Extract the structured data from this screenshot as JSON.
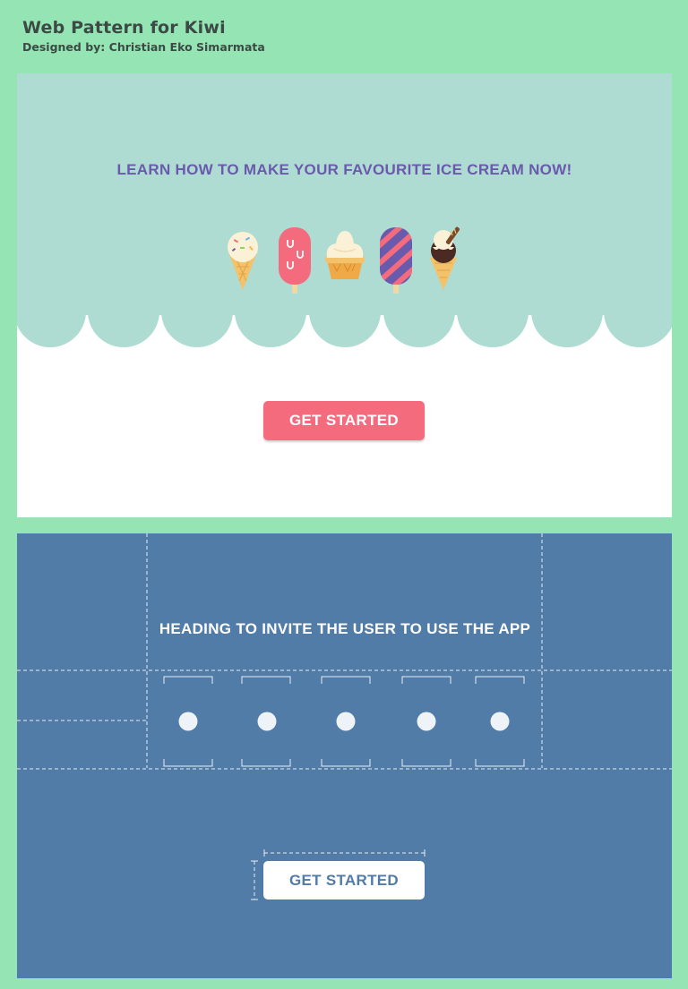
{
  "header": {
    "title": "Web Pattern for Kiwi",
    "subtitle": "Designed by: Christian Eko Simarmata"
  },
  "panel_design": {
    "heading": "LEARN HOW TO MAKE YOUR FAVOURITE ICE CREAM NOW!",
    "icons": [
      "sprinkle-cone-icon",
      "pink-popsicle-icon",
      "cupcake-cone-icon",
      "striped-popsicle-icon",
      "chocolate-cone-icon"
    ],
    "cta_label": "GET STARTED",
    "colors": {
      "hero_bg": "#aedcd3",
      "heading": "#6a5aac",
      "cta": "#f56b7e"
    }
  },
  "panel_wireframe": {
    "heading": "HEADING TO INVITE THE USER TO USE THE APP",
    "cta_label": "GET STARTED",
    "colors": {
      "bg": "#517ca8",
      "cta_text": "#517ca8"
    }
  },
  "page_bg": "#95e5b4"
}
